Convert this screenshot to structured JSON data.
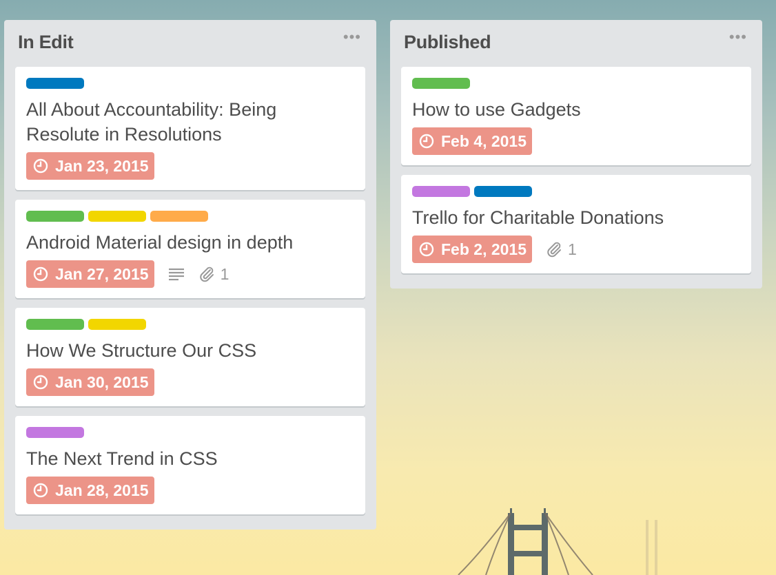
{
  "colors": {
    "blue": "#0079bf",
    "green": "#61bd4f",
    "yellow": "#f2d600",
    "orange": "#ffab4a",
    "purple": "#c377e0",
    "due_badge": "#ec9488"
  },
  "lists": [
    {
      "title": "In Edit",
      "menu_icon": "more-horizontal-icon",
      "cards": [
        {
          "labels": [
            "blue"
          ],
          "title": "All About Accountability: Being Resolute in Resolutions",
          "due": "Jan 23, 2015"
        },
        {
          "labels": [
            "green",
            "yellow",
            "orange"
          ],
          "title": "Android Material design in depth",
          "due": "Jan 27, 2015",
          "has_description": true,
          "attachments": "1"
        },
        {
          "labels": [
            "green",
            "yellow"
          ],
          "title": "How We Structure Our CSS",
          "due": "Jan 30, 2015"
        },
        {
          "labels": [
            "purple"
          ],
          "title": "The Next Trend in CSS",
          "due": "Jan 28, 2015"
        }
      ]
    },
    {
      "title": "Published",
      "menu_icon": "more-horizontal-icon",
      "cards": [
        {
          "labels": [
            "green"
          ],
          "title": "How to use Gadgets",
          "due": "Feb 4, 2015"
        },
        {
          "labels": [
            "purple",
            "blue"
          ],
          "title": "Trello for Charitable Donations",
          "due": "Feb 2, 2015",
          "attachments": "1"
        }
      ]
    }
  ]
}
